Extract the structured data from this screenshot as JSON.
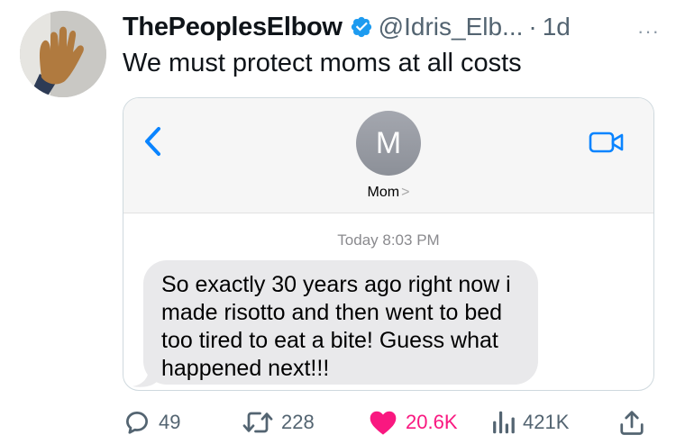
{
  "tweet": {
    "display_name": "ThePeoplesElbow",
    "handle": "@Idris_Elb...",
    "separator": "·",
    "time": "1d",
    "more": "···",
    "text": "We must protect moms at all costs"
  },
  "message_card": {
    "contact_initial": "M",
    "contact_name": "Mom",
    "contact_chevron": ">",
    "timestamp": "Today 8:03 PM",
    "message": "So  exactly 30 years ago right now i made risotto and then went to bed too tired to eat a bite! Guess what happened next!!!"
  },
  "actions": {
    "replies": "49",
    "retweets": "228",
    "likes": "20.6K",
    "views": "421K"
  },
  "colors": {
    "verified": "#1d9bf0",
    "imessage_blue": "#0a84ff",
    "like": "#f91880",
    "muted": "#536471"
  }
}
